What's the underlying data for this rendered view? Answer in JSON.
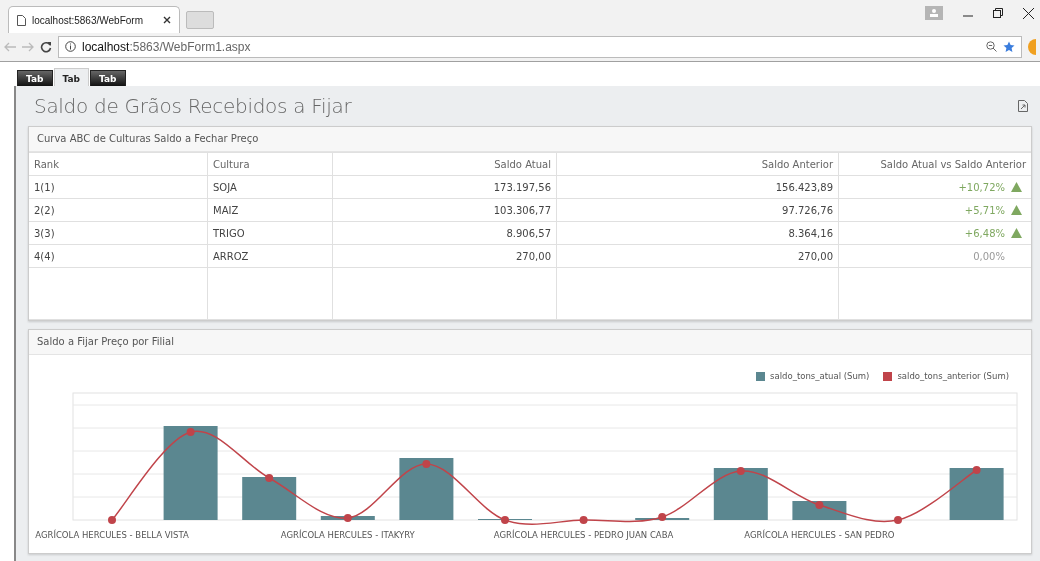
{
  "browser": {
    "tab_title": "localhost:5863/WebForm",
    "url_host": "localhost",
    "url_path": ":5863/WebForm1.aspx"
  },
  "page_tabs": [
    {
      "label": "Tab",
      "selected": false
    },
    {
      "label": "Tab",
      "selected": true
    },
    {
      "label": "Tab",
      "selected": false
    }
  ],
  "title": "Saldo de Grãos Recebidos a Fijar",
  "table_panel": {
    "title": "Curva ABC de Culturas Saldo a Fechar Preço",
    "columns": [
      "Rank",
      "Cultura",
      "Saldo Atual",
      "Saldo Anterior",
      "Saldo Atual vs Saldo Anterior"
    ],
    "rows": [
      {
        "rank": "1(1)",
        "cultura": "SOJA",
        "saldo_atual": "173.197,56",
        "saldo_anterior": "156.423,89",
        "change": "+10,72%",
        "rising": true
      },
      {
        "rank": "2(2)",
        "cultura": "MAIZ",
        "saldo_atual": "103.306,77",
        "saldo_anterior": "97.726,76",
        "change": "+5,71%",
        "rising": true
      },
      {
        "rank": "3(3)",
        "cultura": "TRIGO",
        "saldo_atual": "8.906,57",
        "saldo_anterior": "8.364,16",
        "change": "+6,48%",
        "rising": true
      },
      {
        "rank": "4(4)",
        "cultura": "ARROZ",
        "saldo_atual": "270,00",
        "saldo_anterior": "270,00",
        "change": "0,00%",
        "rising": false
      }
    ]
  },
  "chart_panel": {
    "title": "Saldo a Fijar Preço por Filial",
    "legend": [
      {
        "label": "saldo_tons_atual (Sum)",
        "color": "#5b8790"
      },
      {
        "label": "saldo_tons_anterior (Sum)",
        "color": "#c0444a"
      }
    ],
    "x_labels": [
      "AGRÍCOLA HERCULES - BELLA VISTA",
      "AGRÍCOLA HERCULES - ITAKYRY",
      "AGRÍCOLA HERCULES - PEDRO JUAN CABA",
      "AGRÍCOLA HERCULES - SAN PEDRO"
    ]
  }
}
